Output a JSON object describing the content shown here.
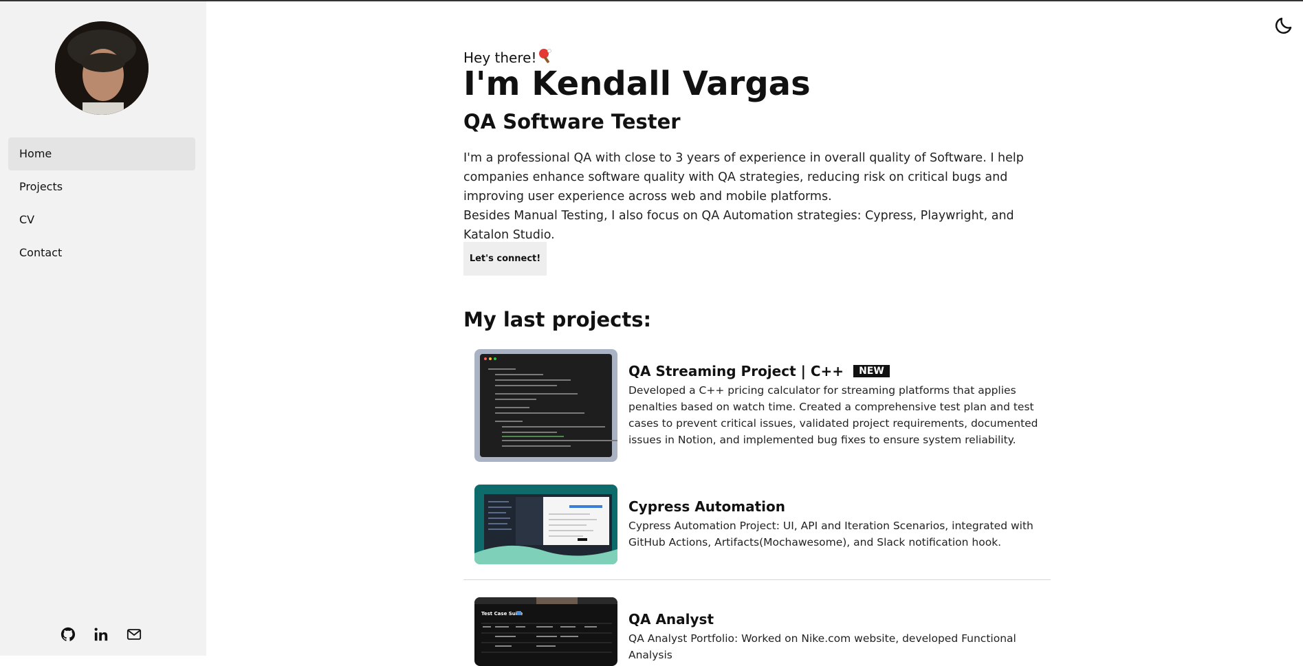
{
  "sidebar": {
    "avatar_alt": "profile-photo",
    "nav": [
      {
        "label": "Home",
        "active": true
      },
      {
        "label": "Projects",
        "active": false
      },
      {
        "label": "CV",
        "active": false
      },
      {
        "label": "Contact",
        "active": false
      }
    ],
    "socials": [
      "github-icon",
      "linkedin-icon",
      "mail-icon"
    ]
  },
  "header": {
    "theme_toggle_icon": "moon-icon"
  },
  "hero": {
    "greeting": "Hey there!",
    "greeting_icon": "ping-pong-paddle-icon",
    "name": "I'm Kendall Vargas",
    "role": "QA Software Tester",
    "bio_1": "I'm a professional QA with close to 3 years of experience in overall quality of Software. I help companies enhance software quality with QA strategies, reducing risk on critical bugs and improving user experience across web and mobile platforms.",
    "bio_2": "Besides Manual Testing, I also focus on QA Automation strategies: Cypress, Playwright, and Katalon Studio.",
    "cta_label": "Let's connect!"
  },
  "projects": {
    "section_title": "My last projects:",
    "items": [
      {
        "title": "QA Streaming Project | C++",
        "badge": "NEW",
        "description": "Developed a C++ pricing calculator for streaming platforms that applies penalties based on watch time. Created a comprehensive test plan and test cases to prevent critical issues, validated project requirements, documented issues in Notion, and implemented bug fixes to ensure system reliability."
      },
      {
        "title": "Cypress Automation",
        "badge": "",
        "description": "Cypress Automation Project: UI, API and Iteration Scenarios, integrated with GitHub Actions, Artifacts(Mochawesome), and Slack notification hook."
      },
      {
        "title": "QA Analyst",
        "badge": "",
        "description": "QA Analyst Portfolio: Worked on Nike.com website, developed Functional Analysis"
      }
    ],
    "thumb3_heading": "Test Case Suite"
  },
  "colors": {
    "sidebar_bg": "#f2f2f2",
    "active_nav_bg": "#e4e4e4",
    "badge_bg": "#111111",
    "cypress_thumb_bg": "#0d6b6b"
  }
}
